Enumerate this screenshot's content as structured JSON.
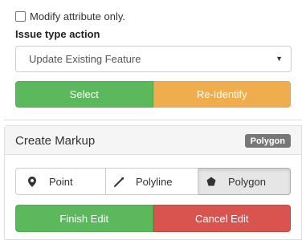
{
  "identify": {
    "modify_only_label": "Modify attribute only.",
    "modify_only_checked": false,
    "issue_type_label": "Issue type action",
    "issue_type_value": "Update Existing Feature",
    "select_label": "Select",
    "reidentify_label": "Re-Identify"
  },
  "markup": {
    "title": "Create Markup",
    "badge": "Polygon",
    "tools": [
      {
        "label": "Point",
        "icon": "map-marker-icon"
      },
      {
        "label": "Polyline",
        "icon": "polyline-icon"
      },
      {
        "label": "Polygon",
        "icon": "polygon-icon",
        "active": true
      }
    ],
    "finish_label": "Finish Edit",
    "cancel_label": "Cancel Edit"
  },
  "colors": {
    "success": "#5cb85c",
    "warning": "#f0ad4e",
    "danger": "#d9534f",
    "badge": "#777777"
  }
}
